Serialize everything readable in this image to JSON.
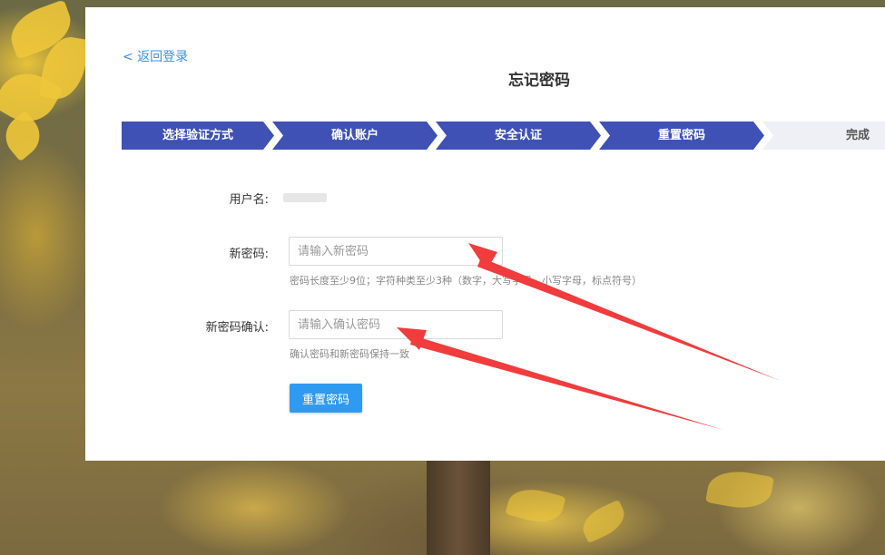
{
  "header": {
    "back_link": "< 返回登录",
    "title": "忘记密码"
  },
  "steps": [
    {
      "label": "选择验证方式",
      "state": "active"
    },
    {
      "label": "确认账户",
      "state": "active"
    },
    {
      "label": "安全认证",
      "state": "active"
    },
    {
      "label": "重置密码",
      "state": "active"
    },
    {
      "label": "完成",
      "state": "pending"
    }
  ],
  "form": {
    "username_label": "用户名:",
    "new_password_label": "新密码:",
    "new_password_placeholder": "请输入新密码",
    "new_password_hint": "密码长度至少9位；字符种类至少3种（数字，大写字母，小写字母，标点符号）",
    "confirm_label": "新密码确认:",
    "confirm_placeholder": "请输入确认密码",
    "confirm_hint": "确认密码和新密码保持一致",
    "submit_label": "重置密码"
  },
  "colors": {
    "step_active": "#3f51b5",
    "step_pending": "#eef0f6",
    "link": "#3d8ee0",
    "primary_button": "#2f9bf0",
    "annotation_arrow": "#f03c3c"
  }
}
